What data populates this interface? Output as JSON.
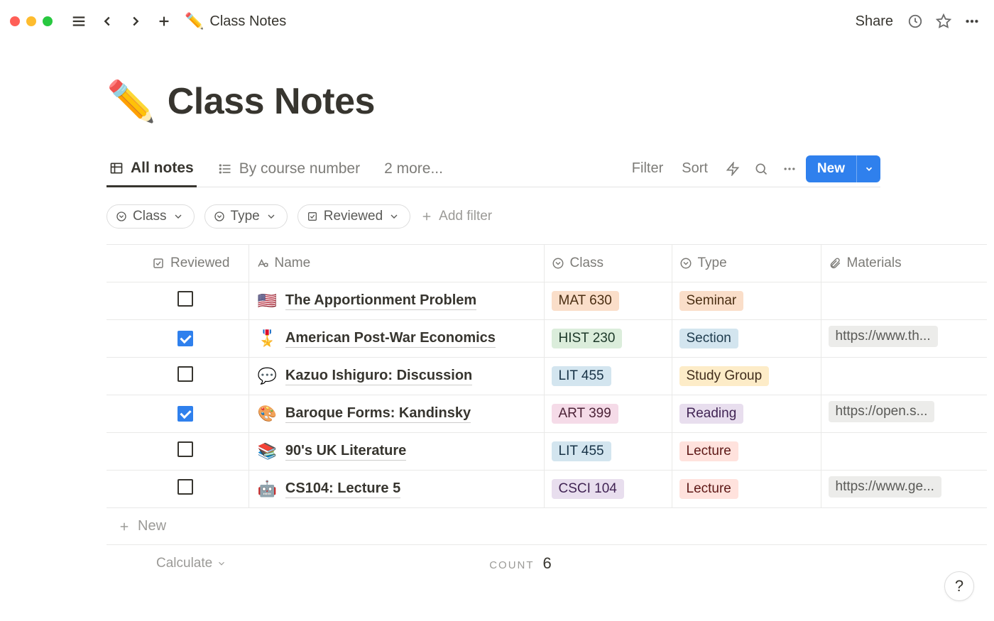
{
  "topbar": {
    "breadcrumb_emoji": "✏️",
    "breadcrumb_label": "Class Notes",
    "share_label": "Share"
  },
  "page": {
    "title_emoji": "✏️",
    "title": "Class Notes"
  },
  "views": {
    "active": {
      "label": "All notes"
    },
    "second": {
      "label": "By course number"
    },
    "more": {
      "label": "2 more..."
    }
  },
  "toolbar": {
    "filter": "Filter",
    "sort": "Sort",
    "new": "New"
  },
  "filters": {
    "class": "Class",
    "type": "Type",
    "reviewed": "Reviewed",
    "add": "Add filter"
  },
  "columns": {
    "reviewed": "Reviewed",
    "name": "Name",
    "class": "Class",
    "type": "Type",
    "materials": "Materials"
  },
  "rows": [
    {
      "reviewed": false,
      "emoji": "🇺🇸",
      "name": "The Apportionment Problem",
      "class": {
        "label": "MAT 630",
        "color": "orange"
      },
      "type": {
        "label": "Seminar",
        "color": "orange"
      },
      "materials": ""
    },
    {
      "reviewed": true,
      "emoji": "🎖️",
      "name": "American Post-War Economics",
      "class": {
        "label": "HIST 230",
        "color": "green"
      },
      "type": {
        "label": "Section",
        "color": "bluel"
      },
      "materials": "https://www.th..."
    },
    {
      "reviewed": false,
      "emoji": "💬",
      "name": "Kazuo Ishiguro: Discussion",
      "class": {
        "label": "LIT 455",
        "color": "blue"
      },
      "type": {
        "label": "Study Group",
        "color": "yellow"
      },
      "materials": ""
    },
    {
      "reviewed": true,
      "emoji": "🎨",
      "name": "Baroque Forms: Kandinsky",
      "class": {
        "label": "ART 399",
        "color": "pink"
      },
      "type": {
        "label": "Reading",
        "color": "purple"
      },
      "materials": "https://open.s..."
    },
    {
      "reviewed": false,
      "emoji": "📚",
      "name": "90's UK Literature",
      "class": {
        "label": "LIT 455",
        "color": "blue"
      },
      "type": {
        "label": "Lecture",
        "color": "red"
      },
      "materials": ""
    },
    {
      "reviewed": false,
      "emoji": "🤖",
      "name": "CS104: Lecture 5",
      "class": {
        "label": "CSCI 104",
        "color": "purple"
      },
      "type": {
        "label": "Lecture",
        "color": "red"
      },
      "materials": "https://www.ge..."
    }
  ],
  "footer": {
    "new_row": "New",
    "calculate": "Calculate",
    "count_label": "COUNT",
    "count_value": "6"
  },
  "help": "?"
}
